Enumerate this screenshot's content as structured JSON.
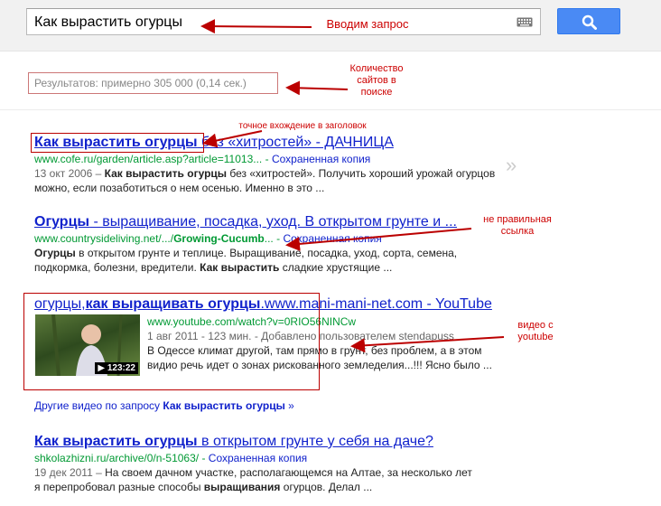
{
  "search": {
    "query": "Как вырастить огурцы",
    "button_icon": "search-icon",
    "keyboard_icon": "keyboard-icon"
  },
  "stats": "Результатов: примерно 305 000 (0,14 сек.)",
  "annotations": {
    "query": "Вводим запрос",
    "stats": "Количество\nсайтов в\nпоиске",
    "exact": "точное вхождение в заголовок",
    "wrong_link": "не правильная\nссылка",
    "video": "видео с\nyoutube",
    "color": "#cc0000"
  },
  "results": [
    {
      "title_bold": "Как вырастить огурцы",
      "title_rest": " без «хитростей» - ДАЧНИЦА",
      "url": "www.cofe.ru/garden/article.asp?article=11013...",
      "cache": "Сохраненная копия",
      "date": "13 окт 2006 –",
      "snippet_bold": "Как вырастить огурцы",
      "snippet": " без «хитростей». Получить хороший урожай огурцов можно, если позаботиться о нем осенью. Именно в это ..."
    },
    {
      "title_bold": "Огурцы",
      "title_rest": " - выращивание, посадка, уход. В открытом грунте и ...",
      "url_main": "www.countrysideliving.net/.../",
      "url_bold": "Growing-Cucumb",
      "url_end": "...",
      "cache": "Сохраненная копия",
      "snippet_bold": "Огурцы",
      "snippet_mid": " в открытом грунте и теплице. Выращивание, посадка, уход, сорта, семена, подкормка, болезни, вредители. ",
      "snippet_bold2": "Как вырастить",
      "snippet_end": " сладкие хрустящие ..."
    },
    {
      "title_a": "огурцы,",
      "title_bold": "как выращивать огурцы",
      "title_rest": ".www.mani-mani-net.com - YouTube",
      "url": "www.youtube.com/watch?v=0RIO56NINCw",
      "meta": "1 авг 2011 - 123 мин. - Добавлено пользователем stendapuss",
      "snippet": "В Одессе климат другой, там прямо в грунт, без проблем, а в этом видио речь идет о зонах рискованного земледелия...!!! Ясно было ...",
      "duration": "▶ 123:22"
    },
    {
      "title_bold": "Как вырастить огурцы",
      "title_rest": " в открытом грунте у себя на даче?",
      "url": "shkolazhizni.ru/archive/0/n-51063/",
      "cache": "Сохраненная копия",
      "date": "19 дек 2011 –",
      "snippet_a": " На своем дачном участке, располагающемся на Алтае, за несколько лет я перепробовал разные способы ",
      "snippet_bold": "выращивания",
      "snippet_end": " огурцов. Делал ..."
    }
  ],
  "more_videos_prefix": "Другие видео по запросу ",
  "more_videos_bold": "Как вырастить огурцы",
  "more_videos_suffix": " »",
  "preview_icon": "»"
}
